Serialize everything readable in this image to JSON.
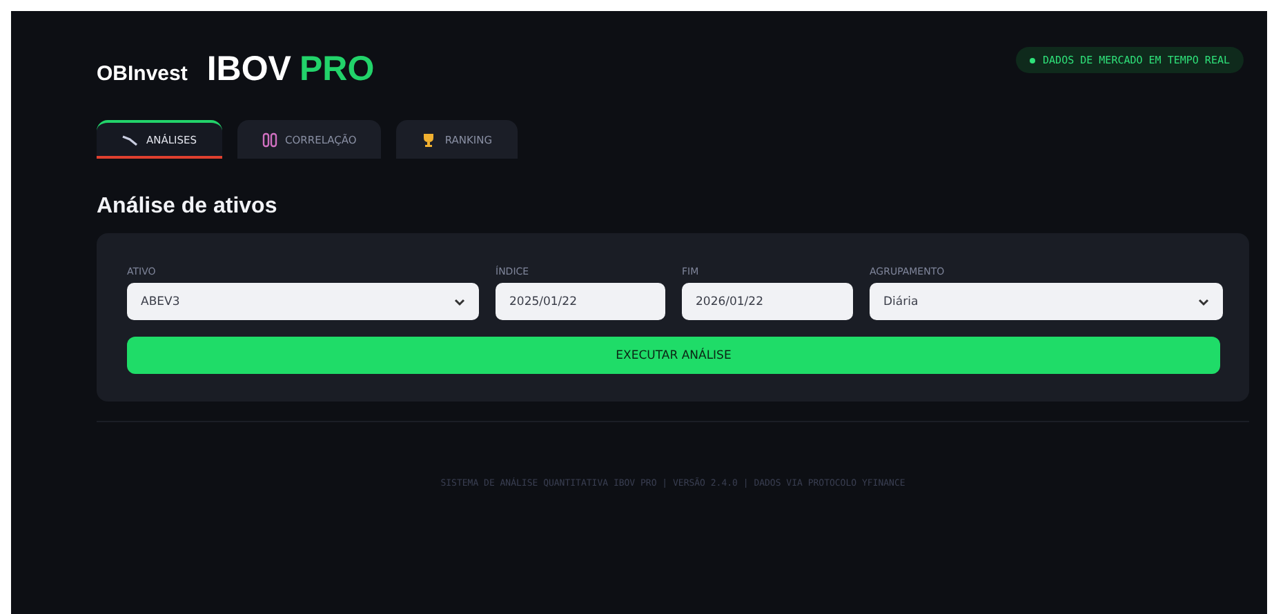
{
  "header": {
    "logo": "OBInvest",
    "title": "IBOV",
    "title_accent": "PRO",
    "status_badge": "DADOS DE MERCADO EM TEMPO REAL"
  },
  "tabs": [
    {
      "label": "ANÁLISES",
      "kind": "chart",
      "selected": true
    },
    {
      "label": "CORRELAÇÃO",
      "kind": "link",
      "selected": false
    },
    {
      "label": "RANKING",
      "kind": "trophy",
      "selected": false
    }
  ],
  "section_title": "Análise de ativos",
  "form": {
    "fields": [
      {
        "label": "ATIVO",
        "value": "ABEV3",
        "kind": "select"
      },
      {
        "label": "ÍNDICE",
        "value": "2025/01/22",
        "kind": "date"
      },
      {
        "label": "FIM",
        "value": "2026/01/22",
        "kind": "date"
      },
      {
        "label": "AGRUPAMENTO",
        "value": "Diária",
        "kind": "select"
      }
    ],
    "submit": "EXECUTAR ANÁLISE"
  },
  "footer": "SISTEMA DE ANÁLISE QUANTITATIVA IBOV PRO | VERSÃO 2.4.0 | DADOS VIA PROTOCOLO YFINANCE"
}
